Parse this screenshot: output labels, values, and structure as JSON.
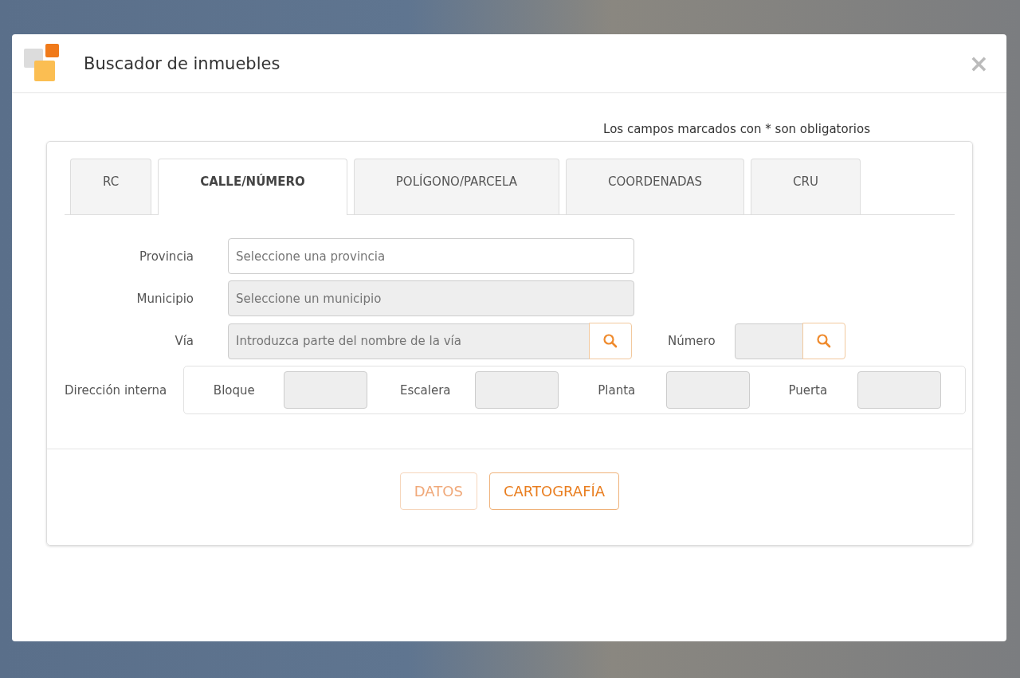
{
  "dialog": {
    "title": "Buscador de inmuebles",
    "close": "×"
  },
  "required_note": "Los campos marcados con * son obligatorios",
  "tabs": [
    {
      "label": "RC",
      "selected": false
    },
    {
      "label": "CALLE/NÚMERO",
      "selected": true
    },
    {
      "label": "POLÍGONO/PARCELA",
      "selected": false
    },
    {
      "label": "COORDENADAS",
      "selected": false
    },
    {
      "label": "CRU",
      "selected": false
    }
  ],
  "fields": [
    {
      "label": "Provincia",
      "placeholder": "Seleccione una provincia",
      "disabled": false,
      "search": false
    },
    {
      "label": "Municipio",
      "placeholder": "Seleccione un municipio",
      "disabled": true,
      "search": false
    },
    {
      "label": "Vía",
      "placeholder": "Introduzca parte del nombre de la vía",
      "disabled": true,
      "search": true
    }
  ],
  "numero": {
    "label": "Número",
    "disabled": true
  },
  "internal_address": {
    "label": "Dirección interna",
    "fields": [
      {
        "label": "Bloque",
        "disabled": true
      },
      {
        "label": "Escalera",
        "disabled": true
      },
      {
        "label": "Planta",
        "disabled": true
      },
      {
        "label": "Puerta",
        "disabled": true
      }
    ]
  },
  "buttons": [
    {
      "label": "DATOS",
      "disabled": true
    },
    {
      "label": "CARTOGRAFÍA",
      "disabled": false
    }
  ]
}
